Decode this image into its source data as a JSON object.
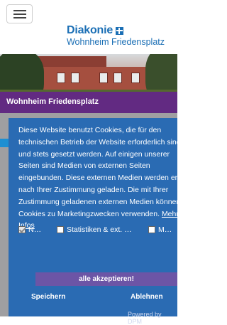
{
  "header": {
    "menu_icon": "hamburger-menu-icon",
    "logo_brand": "Diakonie",
    "logo_icon": "cross-icon",
    "logo_subtitle": "Wohnheim Friedensplatz"
  },
  "hero": {
    "title": "Wohnheim Friedensplatz"
  },
  "cookie_banner": {
    "text": "Diese Website benutzt Cookies, die für den technischen Betrieb der Website erforderlich sind und stets gesetzt werden. Auf einigen unserer Seiten sind Medien von externen Seiten eingebunden. Diese externen Medien werden erst nach Ihrer Zustimmung geladen. Die mit Ihrer Zustimmung geladenen externen Medien können Cookies zu Marketingzwecken verwenden.",
    "more_link": "Mehr Infos",
    "options": [
      {
        "label": "N…",
        "checked": true
      },
      {
        "label": "Statistiken & ext. …",
        "checked": false
      },
      {
        "label": "M…",
        "checked": false
      }
    ],
    "accept_all": "alle akzeptieren!",
    "save": "Speichern",
    "deny": "Ablehnen",
    "powered_by": "Powered by DPM"
  },
  "colors": {
    "brand_blue": "#1b6fb5",
    "title_purple": "#622a82",
    "banner_blue": "#2a6bb3",
    "accept_purple": "#6c55a6"
  }
}
